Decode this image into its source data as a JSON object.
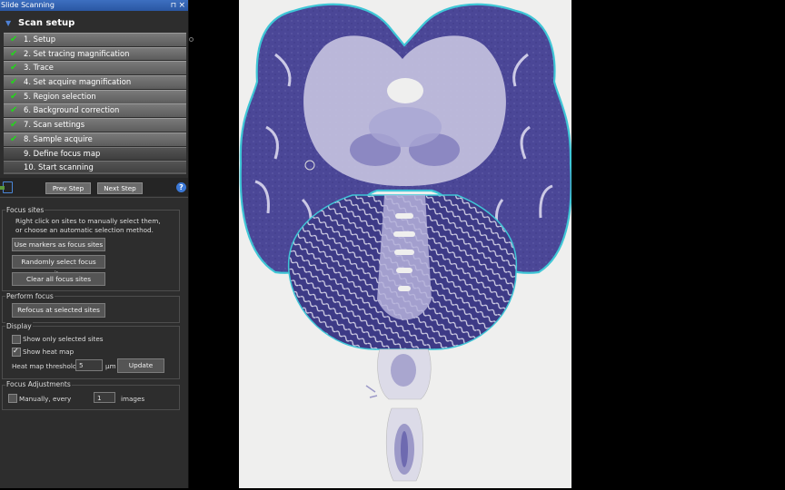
{
  "window": {
    "title": "Slide Scanning"
  },
  "scan_setup": {
    "title": "Scan setup",
    "steps": [
      {
        "label": "1. Setup",
        "done": true
      },
      {
        "label": "2. Set tracing magnification",
        "done": true
      },
      {
        "label": "3. Trace",
        "done": true
      },
      {
        "label": "4. Set acquire magnification",
        "done": true
      },
      {
        "label": "5. Region selection",
        "done": true
      },
      {
        "label": "6. Background correction",
        "done": true
      },
      {
        "label": "7. Scan settings",
        "done": true
      },
      {
        "label": "8. Sample acquire",
        "done": true
      },
      {
        "label": "9. Define focus map",
        "done": false
      },
      {
        "label": "10. Start scanning",
        "done": false
      }
    ]
  },
  "nav": {
    "prev_label": "Prev Step",
    "next_label": "Next Step",
    "help": "?"
  },
  "focus_sites": {
    "title": "Focus sites",
    "instructions_line1": "Right click on sites to manually select them,",
    "instructions_line2": "or choose an automatic selection method.",
    "use_markers_label": "Use markers as focus sites",
    "random_label": "Randomly select focus sites",
    "clear_label": "Clear all focus sites"
  },
  "perform_focus": {
    "title": "Perform focus",
    "refocus_label": "Refocus at selected sites"
  },
  "display": {
    "title": "Display",
    "show_selected_label": "Show only selected sites",
    "show_selected_checked": false,
    "show_heat_label": "Show heat map",
    "show_heat_checked": true,
    "threshold_label": "Heat map threshold",
    "threshold_value": "5",
    "threshold_unit": "µm",
    "update_label": "Update"
  },
  "focus_adjustments": {
    "title": "Focus Adjustments",
    "manually_label": "Manually, every",
    "manually_checked": false,
    "images_value": "1",
    "images_unit": "images"
  },
  "colors": {
    "tissue_stain": "#4a4596",
    "tissue_light": "#c9c7e3",
    "trace_outline": "#3fc6d6",
    "check": "#22d81a",
    "title_bar": "#2a57a3"
  }
}
